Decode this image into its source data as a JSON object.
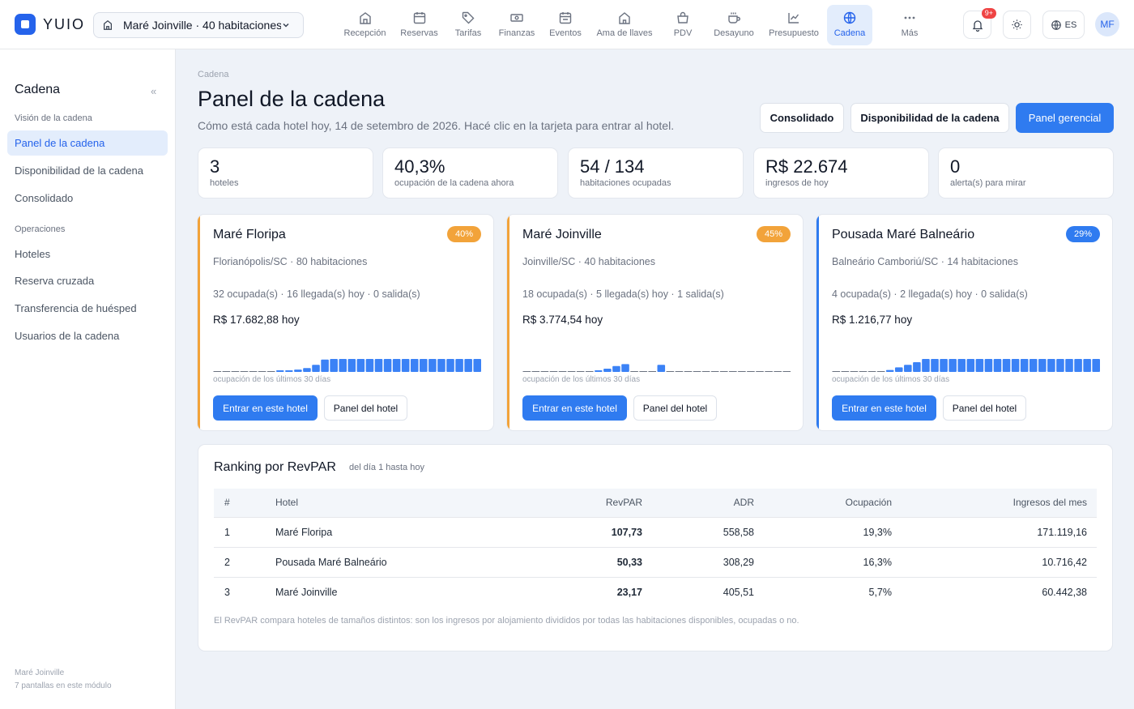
{
  "app": {
    "name": "YUIO"
  },
  "hotel_select": {
    "label": "Maré Joinville · 40 habitaciones"
  },
  "nav": [
    {
      "label": "Recepción",
      "icon": "home-icon"
    },
    {
      "label": "Reservas",
      "icon": "calendar-icon"
    },
    {
      "label": "Tarifas",
      "icon": "tag-icon"
    },
    {
      "label": "Finanzas",
      "icon": "money-icon"
    },
    {
      "label": "Eventos",
      "icon": "calendar-event-icon"
    },
    {
      "label": "Ama de llaves",
      "icon": "house-icon"
    },
    {
      "label": "PDV",
      "icon": "shopping-bag-icon"
    },
    {
      "label": "Desayuno",
      "icon": "coffee-icon"
    },
    {
      "label": "Presupuesto",
      "icon": "chart-line-icon"
    },
    {
      "label": "Cadena",
      "icon": "globe-icon",
      "active": true
    },
    {
      "label": "Más",
      "icon": "more-icon"
    }
  ],
  "topright": {
    "notif_badge": "9+",
    "lang": "ES",
    "avatar": "MF"
  },
  "sidebar": {
    "title": "Cadena",
    "sec1": "Visión de la cadena",
    "items1": [
      "Panel de la cadena",
      "Disponibilidad de la cadena",
      "Consolidado"
    ],
    "sec2": "Operaciones",
    "items2": [
      "Hoteles",
      "Reserva cruzada",
      "Transferencia de huésped",
      "Usuarios de la cadena"
    ],
    "footer1": "Maré Joinville",
    "footer2": "7 pantallas en este módulo"
  },
  "page": {
    "breadcrumb": "Cadena",
    "title": "Panel de la cadena",
    "subtitle": "Cómo está cada hotel hoy, 14 de setembro de 2026. Hacé clic en la tarjeta para entrar al hotel.",
    "buttons": [
      "Consolidado",
      "Disponibilidad de la cadena",
      "Panel gerencial"
    ]
  },
  "kpis": [
    {
      "value": "3",
      "label": "hoteles"
    },
    {
      "value": "40,3%",
      "label": "ocupación de la cadena ahora"
    },
    {
      "value": "54 / 134",
      "label": "habitaciones ocupadas"
    },
    {
      "value": "R$ 22.674",
      "label": "ingresos de hoy"
    },
    {
      "value": "0",
      "label": "alerta(s) para mirar"
    }
  ],
  "hotels": [
    {
      "name": "Maré Floripa",
      "pct": "40%",
      "location": "Florianópolis/SC · 80 habitaciones",
      "stats": "32 ocupada(s) · 16 llegada(s) hoy · 0 salida(s)",
      "revenue": "R$ 17.682,88 hoy",
      "spark_label": "ocupación de los últimos 30 días",
      "btn_enter": "Entrar en este hotel",
      "btn_panel": "Panel del hotel",
      "color": "#f2a33a",
      "spark": [
        0,
        0,
        0,
        0,
        0,
        0,
        0,
        0.05,
        0.1,
        0.18,
        0.3,
        0.55,
        0.95,
        1,
        1,
        1,
        1,
        1,
        1,
        1,
        1,
        1,
        1,
        1,
        1,
        1,
        1,
        1,
        1,
        1
      ]
    },
    {
      "name": "Maré Joinville",
      "pct": "45%",
      "location": "Joinville/SC · 40 habitaciones",
      "stats": "18 ocupada(s) · 5 llegada(s) hoy · 1 salida(s)",
      "revenue": "R$ 3.774,54 hoy",
      "spark_label": "ocupación de los últimos 30 días",
      "btn_enter": "Entrar en este hotel",
      "btn_panel": "Panel del hotel",
      "color": "#f2a33a",
      "spark": [
        0,
        0,
        0,
        0,
        0,
        0,
        0,
        0,
        0.1,
        0.25,
        0.45,
        0.6,
        0,
        0,
        0,
        0.55,
        0,
        0,
        0,
        0,
        0,
        0,
        0,
        0,
        0,
        0,
        0,
        0,
        0,
        0
      ]
    },
    {
      "name": "Pousada Maré Balneário",
      "pct": "29%",
      "location": "Balneário Camboriú/SC · 14 habitaciones",
      "stats": "4 ocupada(s) · 2 llegada(s) hoy · 0 salida(s)",
      "revenue": "R$ 1.216,77 hoy",
      "spark_label": "ocupación de los últimos 30 días",
      "btn_enter": "Entrar en este hotel",
      "btn_panel": "Panel del hotel",
      "color": "#2f7bf0",
      "spark": [
        0,
        0,
        0,
        0,
        0,
        0,
        0.15,
        0.35,
        0.55,
        0.75,
        1,
        1,
        1,
        1,
        1,
        1,
        1,
        1,
        1,
        1,
        1,
        1,
        1,
        1,
        1,
        1,
        1,
        1,
        1,
        1
      ]
    }
  ],
  "ranking": {
    "title": "Ranking por RevPAR",
    "subtitle": "del día 1 hasta hoy",
    "columns": [
      "#",
      "Hotel",
      "RevPAR",
      "ADR",
      "Ocupación",
      "Ingresos del mes"
    ],
    "rows": [
      [
        "1",
        "Maré Floripa",
        "107,73",
        "558,58",
        "19,3%",
        "171.119,16"
      ],
      [
        "2",
        "Pousada Maré Balneário",
        "50,33",
        "308,29",
        "16,3%",
        "10.716,42"
      ],
      [
        "3",
        "Maré Joinville",
        "23,17",
        "405,51",
        "5,7%",
        "60.442,38"
      ]
    ],
    "note": "El RevPAR compara hoteles de tamaños distintos: son los ingresos por alojamiento divididos por todas las habitaciones disponibles, ocupadas o no."
  },
  "colors": {
    "accent": "#2f7bf0",
    "warning": "#f2a33a",
    "sidebar_active_bg": "#e3edfc"
  }
}
